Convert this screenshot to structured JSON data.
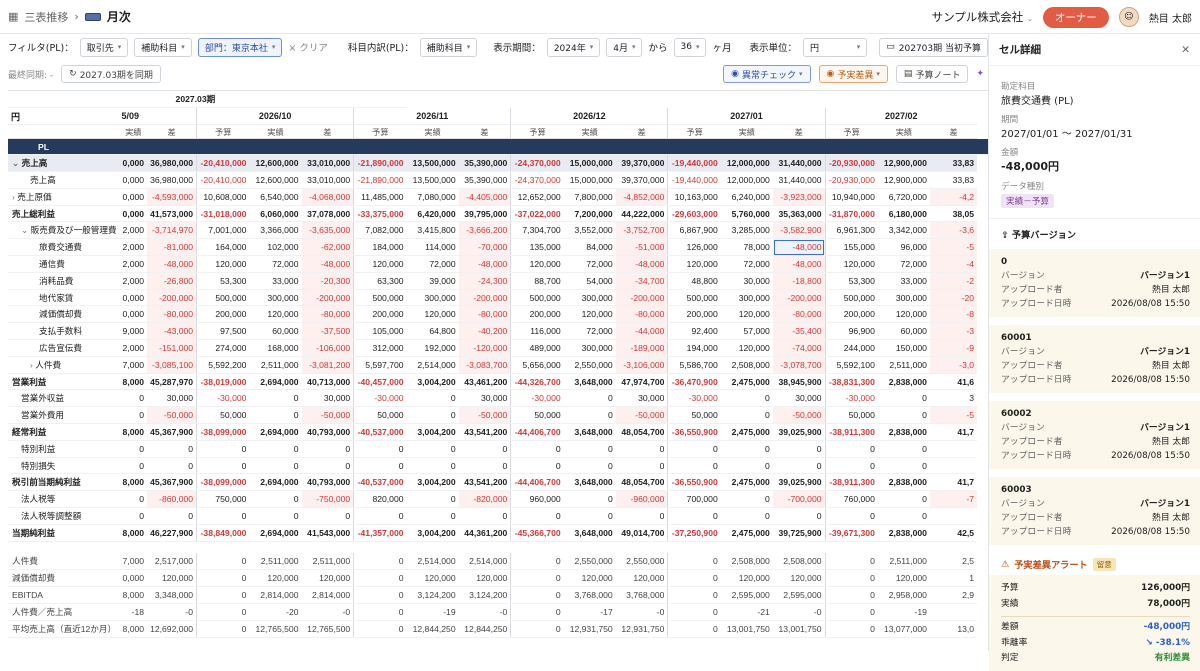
{
  "topbar": {
    "breadcrumb_root": "三表推移",
    "breadcrumb_current": "月次",
    "company": "サンプル株式会社",
    "role": "オーナー",
    "user": "熱目 太郎"
  },
  "filters": {
    "filter_label": "フィルタ(PL)：",
    "f1": "取引先",
    "f2": "補助科目",
    "f3": "部門：東京本社",
    "clear": "× クリア",
    "breakdown_label": "科目内訳(PL)：",
    "breakdown": "補助科目",
    "period_label": "表示期間：",
    "year": "2024年",
    "month": "4月",
    "kara": "から",
    "months": "36",
    "month_unit": "ヶ月",
    "unit_label": "表示単位：",
    "unit": "円",
    "budget": "202703期 当初予算"
  },
  "sync": {
    "last_sync": "最終同期: -",
    "sync_button": "2027.03期を同期",
    "anomaly": "異常チェック",
    "variance": "予実差異",
    "budget_note": "予算ノート"
  },
  "grid": {
    "fy": "2027.03期",
    "unit": "円",
    "partial_month": "5/09",
    "months": [
      "2026/10",
      "2026/11",
      "2026/12",
      "2027/01",
      "2027/02"
    ],
    "subcols": [
      "予算",
      "実績",
      "差"
    ],
    "partial_sub": "実績",
    "section": "PL",
    "rows": [
      {
        "label": "売上高",
        "cls": "sec",
        "indent": 0,
        "caret": "v",
        "v": [
          "0,000",
          "36,980,000",
          "-20,410,000",
          "12,600,000",
          "33,010,000",
          "-21,890,000",
          "13,500,000",
          "35,390,000",
          "-24,370,000",
          "15,000,000",
          "39,370,000",
          "-19,440,000",
          "12,000,000",
          "31,440,000",
          "-20,930,000",
          "12,900,000",
          "33,83"
        ]
      },
      {
        "label": "売上高",
        "cls": "",
        "indent": 2,
        "v": [
          "0,000",
          "36,980,000",
          "-20,410,000",
          "12,600,000",
          "33,010,000",
          "-21,890,000",
          "13,500,000",
          "35,390,000",
          "-24,370,000",
          "15,000,000",
          "39,370,000",
          "-19,440,000",
          "12,000,000",
          "31,440,000",
          "-20,930,000",
          "12,900,000",
          "33,83"
        ]
      },
      {
        "label": "売上原価",
        "cls": "",
        "indent": 0,
        "caret": ">",
        "v": [
          "0,000",
          "-4,593,000",
          "10,608,000",
          "6,540,000",
          "-4,068,000",
          "11,485,000",
          "7,080,000",
          "-4,405,000",
          "12,652,000",
          "7,800,000",
          "-4,852,000",
          "10,163,000",
          "6,240,000",
          "-3,923,000",
          "10,940,000",
          "6,720,000",
          "-4,2"
        ]
      },
      {
        "label": "売上総利益",
        "cls": "sum",
        "indent": 0,
        "v": [
          "0,000",
          "41,573,000",
          "-31,018,000",
          "6,060,000",
          "37,078,000",
          "-33,375,000",
          "6,420,000",
          "39,795,000",
          "-37,022,000",
          "7,200,000",
          "44,222,000",
          "-29,603,000",
          "5,760,000",
          "35,363,000",
          "-31,870,000",
          "6,180,000",
          "38,05"
        ]
      },
      {
        "label": "販売費及び一般管理費",
        "cls": "",
        "indent": 1,
        "caret": "v",
        "v": [
          "2,000",
          "-3,714,970",
          "7,001,000",
          "3,366,000",
          "-3,635,000",
          "7,082,000",
          "3,415,800",
          "-3,666,200",
          "7,304,700",
          "3,552,000",
          "-3,752,700",
          "6,867,900",
          "3,285,000",
          "-3,582,900",
          "6,961,300",
          "3,342,000",
          "-3,6"
        ]
      },
      {
        "label": "旅費交通費",
        "cls": "",
        "indent": 3,
        "v": [
          "2,000",
          "-81,000",
          "164,000",
          "102,000",
          "-62,000",
          "184,000",
          "114,000",
          "-70,000",
          "135,000",
          "84,000",
          "-51,000",
          "126,000",
          "78,000",
          "-48,000",
          "155,000",
          "96,000",
          "-5"
        ]
      },
      {
        "label": "通信費",
        "cls": "",
        "indent": 3,
        "v": [
          "2,000",
          "-48,000",
          "120,000",
          "72,000",
          "-48,000",
          "120,000",
          "72,000",
          "-48,000",
          "120,000",
          "72,000",
          "-48,000",
          "120,000",
          "72,000",
          "-48,000",
          "120,000",
          "72,000",
          "-4"
        ]
      },
      {
        "label": "消耗品費",
        "cls": "",
        "indent": 3,
        "v": [
          "2,000",
          "-26,800",
          "53,300",
          "33,000",
          "-20,300",
          "63,300",
          "39,000",
          "-24,300",
          "88,700",
          "54,000",
          "-34,700",
          "48,800",
          "30,000",
          "-18,800",
          "53,300",
          "33,000",
          "-2"
        ]
      },
      {
        "label": "地代家賃",
        "cls": "",
        "indent": 3,
        "v": [
          "0,000",
          "-200,000",
          "500,000",
          "300,000",
          "-200,000",
          "500,000",
          "300,000",
          "-200,000",
          "500,000",
          "300,000",
          "-200,000",
          "500,000",
          "300,000",
          "-200,000",
          "500,000",
          "300,000",
          "-20"
        ]
      },
      {
        "label": "減価償却費",
        "cls": "",
        "indent": 3,
        "v": [
          "0,000",
          "-80,000",
          "200,000",
          "120,000",
          "-80,000",
          "200,000",
          "120,000",
          "-80,000",
          "200,000",
          "120,000",
          "-80,000",
          "200,000",
          "120,000",
          "-80,000",
          "200,000",
          "120,000",
          "-8"
        ]
      },
      {
        "label": "支払手数料",
        "cls": "",
        "indent": 3,
        "v": [
          "9,000",
          "-43,000",
          "97,500",
          "60,000",
          "-37,500",
          "105,000",
          "64,800",
          "-40,200",
          "116,000",
          "72,000",
          "-44,000",
          "92,400",
          "57,000",
          "-35,400",
          "96,900",
          "60,000",
          "-3"
        ]
      },
      {
        "label": "広告宣伝費",
        "cls": "",
        "indent": 3,
        "v": [
          "2,000",
          "-151,000",
          "274,000",
          "168,000",
          "-106,000",
          "312,000",
          "192,000",
          "-120,000",
          "489,000",
          "300,000",
          "-189,000",
          "194,000",
          "120,000",
          "-74,000",
          "244,000",
          "150,000",
          "-9"
        ]
      },
      {
        "label": "人件費",
        "cls": "",
        "indent": 2,
        "caret": ">",
        "v": [
          "7,000",
          "-3,085,100",
          "5,592,200",
          "2,511,000",
          "-3,081,200",
          "5,597,700",
          "2,514,000",
          "-3,083,700",
          "5,656,000",
          "2,550,000",
          "-3,106,000",
          "5,586,700",
          "2,508,000",
          "-3,078,700",
          "5,592,100",
          "2,511,000",
          "-3,0"
        ]
      },
      {
        "label": "営業利益",
        "cls": "sum",
        "indent": 0,
        "v": [
          "8,000",
          "45,287,970",
          "-38,019,000",
          "2,694,000",
          "40,713,000",
          "-40,457,000",
          "3,004,200",
          "43,461,200",
          "-44,326,700",
          "3,648,000",
          "47,974,700",
          "-36,470,900",
          "2,475,000",
          "38,945,900",
          "-38,831,300",
          "2,838,000",
          "41,6"
        ]
      },
      {
        "label": "営業外収益",
        "cls": "",
        "indent": 1,
        "v": [
          "0",
          "30,000",
          "-30,000",
          "0",
          "30,000",
          "-30,000",
          "0",
          "30,000",
          "-30,000",
          "0",
          "30,000",
          "-30,000",
          "0",
          "30,000",
          "-30,000",
          "0",
          "3"
        ]
      },
      {
        "label": "営業外費用",
        "cls": "",
        "indent": 1,
        "v": [
          "0",
          "-50,000",
          "50,000",
          "0",
          "-50,000",
          "50,000",
          "0",
          "-50,000",
          "50,000",
          "0",
          "-50,000",
          "50,000",
          "0",
          "-50,000",
          "50,000",
          "0",
          "-5"
        ]
      },
      {
        "label": "経常利益",
        "cls": "sum",
        "indent": 0,
        "v": [
          "8,000",
          "45,367,900",
          "-38,099,000",
          "2,694,000",
          "40,793,000",
          "-40,537,000",
          "3,004,200",
          "43,541,200",
          "-44,406,700",
          "3,648,000",
          "48,054,700",
          "-36,550,900",
          "2,475,000",
          "39,025,900",
          "-38,911,300",
          "2,838,000",
          "41,7"
        ]
      },
      {
        "label": "特別利益",
        "cls": "",
        "indent": 1,
        "v": [
          "0",
          "0",
          "0",
          "0",
          "0",
          "0",
          "0",
          "0",
          "0",
          "0",
          "0",
          "0",
          "0",
          "0",
          "0",
          "0",
          ""
        ]
      },
      {
        "label": "特別損失",
        "cls": "",
        "indent": 1,
        "v": [
          "0",
          "0",
          "0",
          "0",
          "0",
          "0",
          "0",
          "0",
          "0",
          "0",
          "0",
          "0",
          "0",
          "0",
          "0",
          "0",
          ""
        ]
      },
      {
        "label": "税引前当期純利益",
        "cls": "sum",
        "indent": 0,
        "v": [
          "8,000",
          "45,367,900",
          "-38,099,000",
          "2,694,000",
          "40,793,000",
          "-40,537,000",
          "3,004,200",
          "43,541,200",
          "-44,406,700",
          "3,648,000",
          "48,054,700",
          "-36,550,900",
          "2,475,000",
          "39,025,900",
          "-38,911,300",
          "2,838,000",
          "41,7"
        ]
      },
      {
        "label": "法人税等",
        "cls": "",
        "indent": 1,
        "v": [
          "0",
          "-860,000",
          "750,000",
          "0",
          "-750,000",
          "820,000",
          "0",
          "-820,000",
          "960,000",
          "0",
          "-960,000",
          "700,000",
          "0",
          "-700,000",
          "760,000",
          "0",
          "-7"
        ]
      },
      {
        "label": "法人税等調整額",
        "cls": "",
        "indent": 1,
        "v": [
          "0",
          "0",
          "0",
          "0",
          "0",
          "0",
          "0",
          "0",
          "0",
          "0",
          "0",
          "0",
          "0",
          "0",
          "0",
          "0",
          ""
        ]
      },
      {
        "label": "当期純利益",
        "cls": "sum",
        "indent": 0,
        "v": [
          "8,000",
          "46,227,900",
          "-38,849,000",
          "2,694,000",
          "41,543,000",
          "-41,357,000",
          "3,004,200",
          "44,361,200",
          "-45,366,700",
          "3,648,000",
          "49,014,700",
          "-37,250,900",
          "2,475,000",
          "39,725,900",
          "-39,671,300",
          "2,838,000",
          "42,5"
        ]
      },
      {
        "label": "",
        "cls": "gap",
        "indent": 0,
        "v": []
      },
      {
        "label": "人件費",
        "cls": "kpi",
        "indent": 0,
        "v": [
          "7,000",
          "2,517,000",
          "0",
          "2,511,000",
          "2,511,000",
          "0",
          "2,514,000",
          "2,514,000",
          "0",
          "2,550,000",
          "2,550,000",
          "0",
          "2,508,000",
          "2,508,000",
          "0",
          "2,511,000",
          "2,5"
        ]
      },
      {
        "label": "減価償却費",
        "cls": "kpi",
        "indent": 0,
        "v": [
          "0,000",
          "120,000",
          "0",
          "120,000",
          "120,000",
          "0",
          "120,000",
          "120,000",
          "0",
          "120,000",
          "120,000",
          "0",
          "120,000",
          "120,000",
          "0",
          "120,000",
          "1"
        ]
      },
      {
        "label": "EBITDA",
        "cls": "kpi",
        "indent": 0,
        "v": [
          "8,000",
          "3,348,000",
          "0",
          "2,814,000",
          "2,814,000",
          "0",
          "3,124,200",
          "3,124,200",
          "0",
          "3,768,000",
          "3,768,000",
          "0",
          "2,595,000",
          "2,595,000",
          "0",
          "2,958,000",
          "2,9"
        ]
      },
      {
        "label": "人件費／売上高",
        "cls": "kpi",
        "indent": 0,
        "v": [
          "-18",
          "-0",
          "0",
          "-20",
          "-0",
          "0",
          "-19",
          "-0",
          "0",
          "-17",
          "-0",
          "0",
          "-21",
          "-0",
          "0",
          "-19",
          ""
        ]
      },
      {
        "label": "平均売上高（直近12か月）",
        "cls": "kpi",
        "indent": 0,
        "v": [
          "8,000",
          "12,692,000",
          "0",
          "12,765,500",
          "12,765,500",
          "0",
          "12,844,250",
          "12,844,250",
          "0",
          "12,931,750",
          "12,931,750",
          "0",
          "13,001,750",
          "13,001,750",
          "0",
          "13,077,000",
          "13,0"
        ]
      }
    ]
  },
  "panel": {
    "title": "セル詳細",
    "account_label": "勘定科目",
    "account": "旅費交通費 (PL)",
    "period_label": "期間",
    "period": "2027/01/01 〜 2027/01/31",
    "amount_label": "金額",
    "amount": "-48,000円",
    "dtype_label": "データ種別",
    "dtype": "実績－予算",
    "versions_title": "予算バージョン",
    "k_version": "バージョン",
    "k_uploader": "アップロード者",
    "k_date": "アップロード日時",
    "versions": [
      {
        "id": "0",
        "version": "バージョン1",
        "uploader": "熱目 太郎",
        "date": "2026/08/08 15:50"
      },
      {
        "id": "60001",
        "version": "バージョン1",
        "uploader": "熱目 太郎",
        "date": "2026/08/08 15:50"
      },
      {
        "id": "60002",
        "version": "バージョン1",
        "uploader": "熱目 太郎",
        "date": "2026/08/08 15:50"
      },
      {
        "id": "60003",
        "version": "バージョン1",
        "uploader": "熱目 太郎",
        "date": "2026/08/08 15:50"
      }
    ],
    "alert_title": "予実差異アラート",
    "alert_badge": "留意",
    "alert": {
      "k_budget": "予算",
      "budget": "126,000円",
      "k_actual": "実績",
      "actual": "78,000円",
      "k_diff": "差額",
      "diff": "-48,000円",
      "k_rate": "乖離率",
      "rate": "↘ -38.1%",
      "k_verdict": "判定",
      "verdict": "有利差異"
    }
  },
  "colors": {
    "accent": "#263a5e",
    "negative": "#d13838",
    "owner": "#e25b45"
  }
}
